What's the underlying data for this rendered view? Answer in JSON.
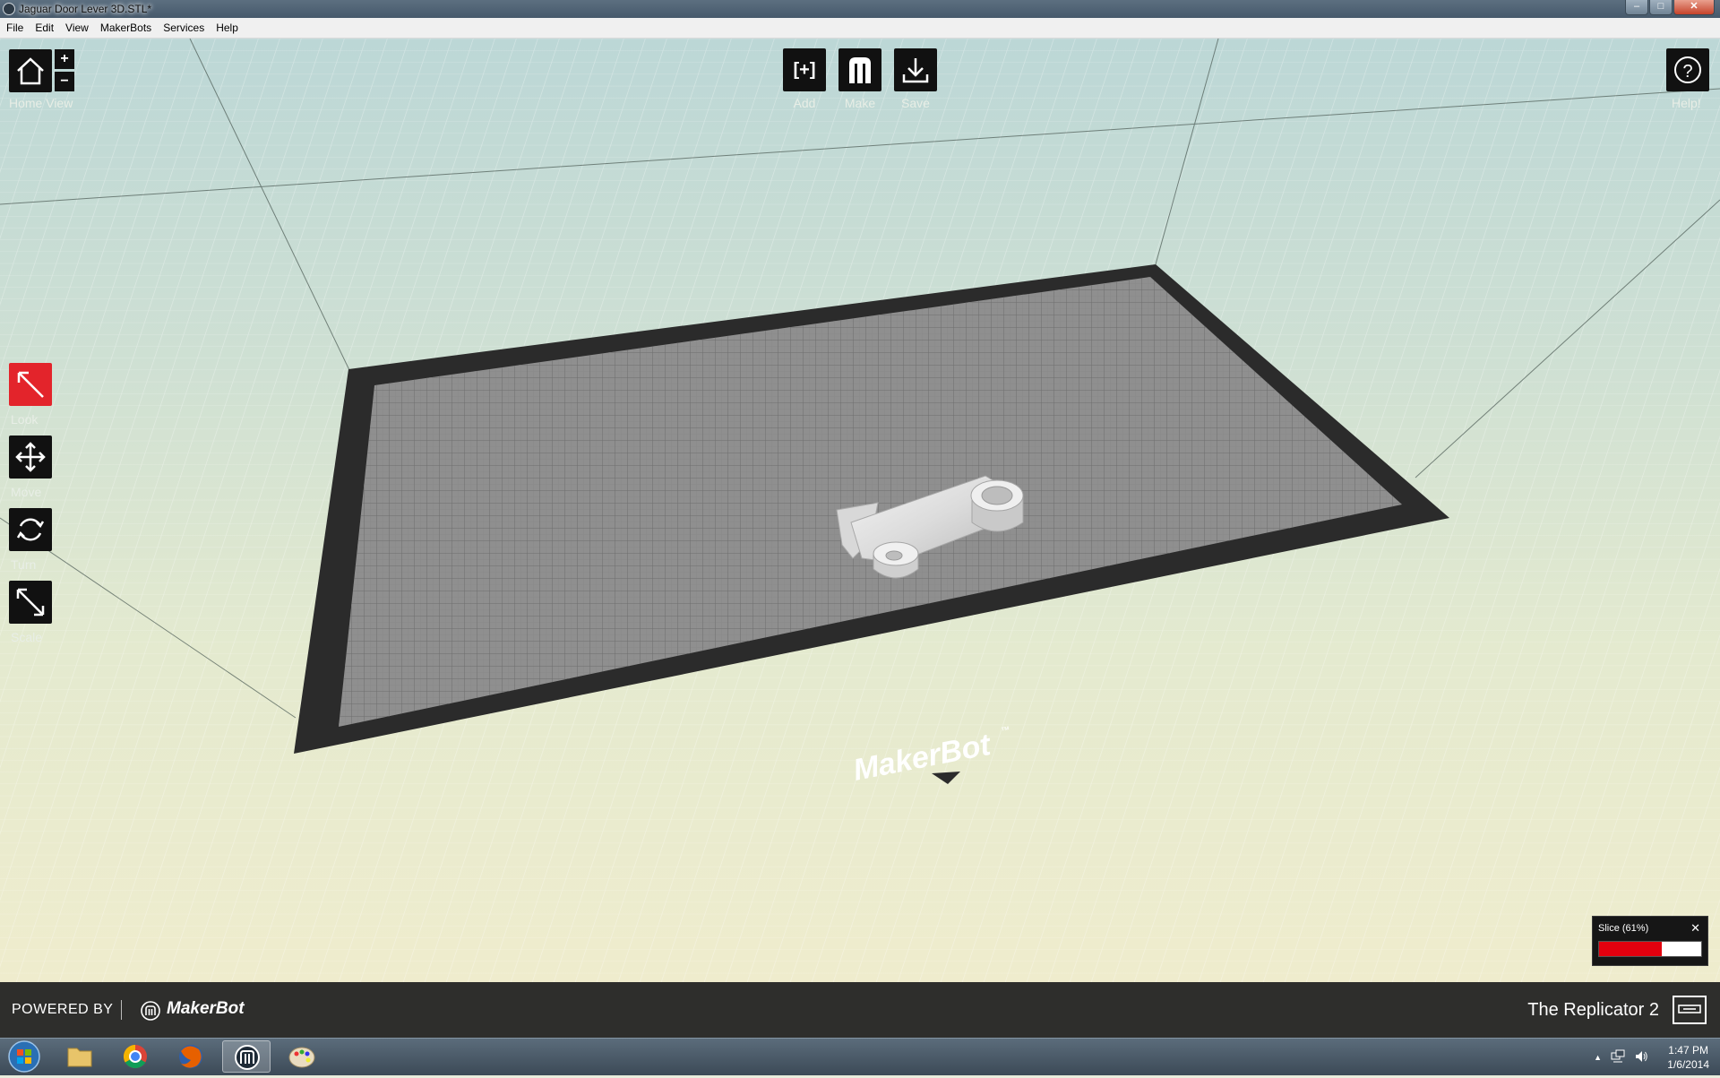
{
  "window": {
    "title": "Jaguar Door Lever 3D.STL*",
    "controls": [
      "–",
      "□",
      "✕"
    ]
  },
  "menu": [
    "File",
    "Edit",
    "View",
    "MakerBots",
    "Services",
    "Help"
  ],
  "toolbar": {
    "home_label": "Home View",
    "zoom_in": "+",
    "zoom_out": "−",
    "add_label": "Add",
    "make_label": "Make",
    "save_label": "Save",
    "help_label": "Help!",
    "add_glyph": "[+]",
    "help_glyph": "?"
  },
  "tools": [
    {
      "label": "Look",
      "icon": "look-arrow-icon",
      "active": true
    },
    {
      "label": "Move",
      "icon": "move-arrows-icon",
      "active": false
    },
    {
      "label": "Turn",
      "icon": "turn-arrows-icon",
      "active": false
    },
    {
      "label": "Scale",
      "icon": "scale-arrow-icon",
      "active": false
    }
  ],
  "build_plate": {
    "brand": "MakerBot",
    "trademark": "™"
  },
  "slice": {
    "label": "Slice (61%)",
    "progress": 0.61,
    "close": "✕"
  },
  "footer": {
    "powered_by": "POWERED BY",
    "brand": "MakerBot",
    "printer": "The Replicator 2"
  },
  "taskbar": {
    "time": "1:47 PM",
    "date": "1/6/2014",
    "tray_up": "▲"
  },
  "colors": {
    "accent_red": "#e3242b",
    "plate_gray": "#8f8f8f",
    "plate_border": "#2b2b2b",
    "footer": "#2e2e2c"
  }
}
